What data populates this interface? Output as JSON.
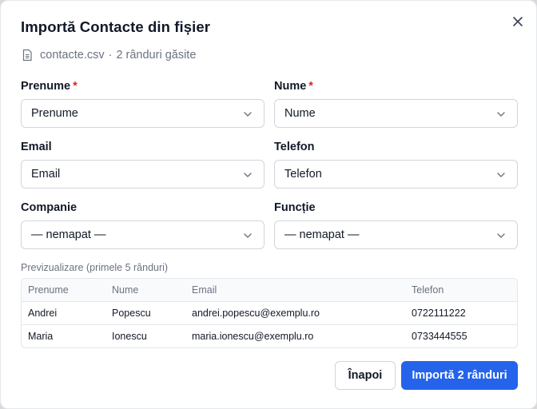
{
  "dialog": {
    "title": "Importă Contacte din fișier",
    "file_name": "contacte.csv",
    "separator": "·",
    "rows_found": "2 rânduri găsite"
  },
  "fields": {
    "prenume": {
      "label": "Prenume",
      "required_mark": "*",
      "value": "Prenume"
    },
    "nume": {
      "label": "Nume",
      "required_mark": "*",
      "value": "Nume"
    },
    "email": {
      "label": "Email",
      "value": "Email"
    },
    "telefon": {
      "label": "Telefon",
      "value": "Telefon"
    },
    "companie": {
      "label": "Companie",
      "value": "— nemapat —"
    },
    "functie": {
      "label": "Funcție",
      "value": "— nemapat —"
    }
  },
  "preview": {
    "label": "Previzualizare (primele 5 rânduri)",
    "headers": [
      "Prenume",
      "Nume",
      "Email",
      "Telefon"
    ],
    "rows": [
      [
        "Andrei",
        "Popescu",
        "andrei.popescu@exemplu.ro",
        "0722111222"
      ],
      [
        "Maria",
        "Ionescu",
        "maria.ionescu@exemplu.ro",
        "0733444555"
      ]
    ]
  },
  "actions": {
    "back_label": "Înapoi",
    "import_label": "Importă 2 rânduri"
  },
  "icons": {
    "close": "close-icon",
    "file": "file-csv-icon",
    "chevron": "chevron-down-icon"
  },
  "colors": {
    "accent": "#2563eb",
    "required": "#dc2626",
    "muted_text": "#6b7280"
  }
}
